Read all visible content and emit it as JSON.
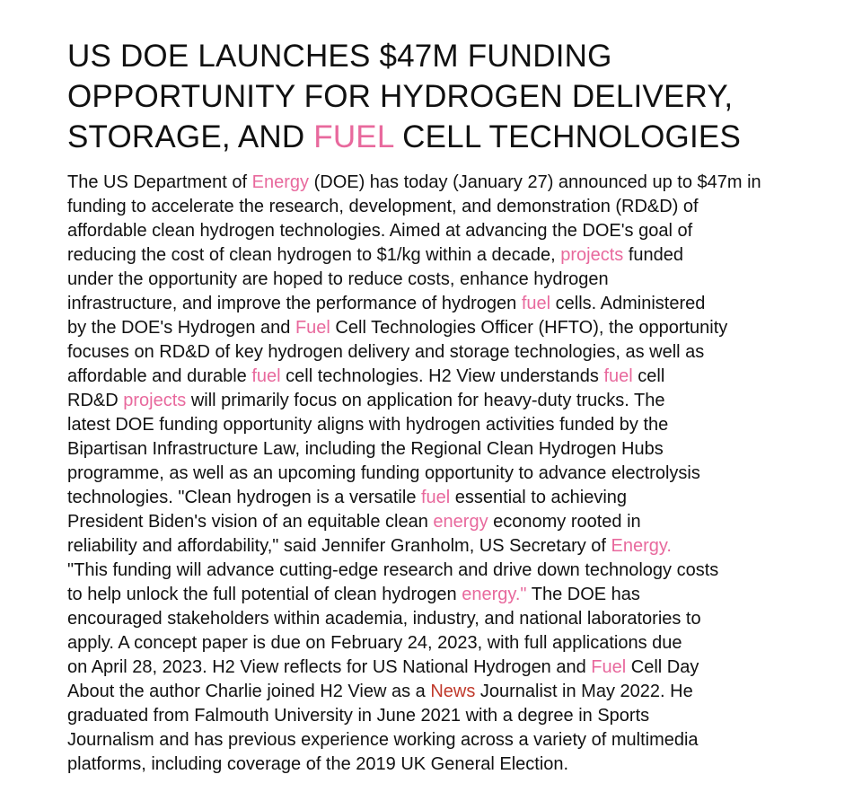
{
  "colors": {
    "keyword_pink": "#e8699d",
    "keyword_red": "#c0392b",
    "text": "#111111",
    "background": "#ffffff"
  },
  "title": {
    "lines": [
      [
        {
          "t": "US DOE LAUNCHES $47M FUNDING"
        }
      ],
      [
        {
          "t": "OPPORTUNITY FOR HYDROGEN DELIVERY,"
        }
      ],
      [
        {
          "t": "STORAGE, AND "
        },
        {
          "t": "FUEL",
          "link": "pink"
        },
        {
          "t": " CELL TECHNOLOGIES"
        }
      ]
    ]
  },
  "body": {
    "lines": [
      [
        {
          "t": "The US Department of "
        },
        {
          "t": "Energy",
          "link": "pink"
        },
        {
          "t": " (DOE) has today (January 27) announced up to $47m in"
        }
      ],
      [
        {
          "t": "funding to accelerate the research, development, and demonstration (RD&D) of"
        }
      ],
      [
        {
          "t": "affordable clean hydrogen technologies. Aimed at advancing the DOE's goal of"
        }
      ],
      [
        {
          "t": "reducing the cost of clean hydrogen to $1/kg within a decade, "
        },
        {
          "t": "projects",
          "link": "pink"
        },
        {
          "t": " funded"
        }
      ],
      [
        {
          "t": "under the opportunity are hoped to reduce costs, enhance hydrogen"
        }
      ],
      [
        {
          "t": "infrastructure, and improve the performance of hydrogen "
        },
        {
          "t": "fuel",
          "link": "pink"
        },
        {
          "t": " cells. Administered"
        }
      ],
      [
        {
          "t": "by the DOE's Hydrogen and "
        },
        {
          "t": "Fuel",
          "link": "pink"
        },
        {
          "t": " Cell Technologies Officer (HFTO), the opportunity"
        }
      ],
      [
        {
          "t": "focuses on RD&D of key hydrogen delivery and storage technologies, as well as"
        }
      ],
      [
        {
          "t": "affordable and durable "
        },
        {
          "t": "fuel",
          "link": "pink"
        },
        {
          "t": " cell technologies. H2 View understands "
        },
        {
          "t": "fuel",
          "link": "pink"
        },
        {
          "t": " cell"
        }
      ],
      [
        {
          "t": "RD&D "
        },
        {
          "t": "projects",
          "link": "pink"
        },
        {
          "t": " will primarily focus on application for heavy-duty trucks. The"
        }
      ],
      [
        {
          "t": "latest DOE funding opportunity aligns with hydrogen activities funded by the"
        }
      ],
      [
        {
          "t": "Bipartisan Infrastructure Law, including the Regional Clean Hydrogen Hubs"
        }
      ],
      [
        {
          "t": "programme, as well as an upcoming funding opportunity to advance electrolysis"
        }
      ],
      [
        {
          "t": "technologies. \"Clean hydrogen is a versatile "
        },
        {
          "t": "fuel",
          "link": "pink"
        },
        {
          "t": " essential to achieving"
        }
      ],
      [
        {
          "t": "President Biden's vision of an equitable clean "
        },
        {
          "t": "energy",
          "link": "pink"
        },
        {
          "t": " economy rooted in"
        }
      ],
      [
        {
          "t": "reliability and affordability,\" said Jennifer Granholm, US Secretary of "
        },
        {
          "t": "Energy.",
          "link": "pink"
        }
      ],
      [
        {
          "t": "\"This funding will advance cutting-edge research and drive down technology costs"
        }
      ],
      [
        {
          "t": "to help unlock the full potential of clean hydrogen "
        },
        {
          "t": "energy.\"",
          "link": "pink"
        },
        {
          "t": " The DOE has"
        }
      ],
      [
        {
          "t": "encouraged stakeholders within academia, industry, and national laboratories to"
        }
      ],
      [
        {
          "t": "apply. A concept paper is due on February 24, 2023, with full applications due"
        }
      ],
      [
        {
          "t": "on April 28, 2023. H2 View reflects for US National Hydrogen and "
        },
        {
          "t": "Fuel",
          "link": "pink"
        },
        {
          "t": " Cell Day"
        }
      ],
      [
        {
          "t": "About the author Charlie joined H2 View as a "
        },
        {
          "t": "News",
          "link": "red"
        },
        {
          "t": " Journalist in May 2022. He"
        }
      ],
      [
        {
          "t": "graduated from Falmouth University in June 2021 with a degree in Sports"
        }
      ],
      [
        {
          "t": "Journalism and has previous experience working across a variety of multimedia"
        }
      ],
      [
        {
          "t": "platforms, including coverage of the 2019 UK General Election."
        }
      ]
    ]
  }
}
